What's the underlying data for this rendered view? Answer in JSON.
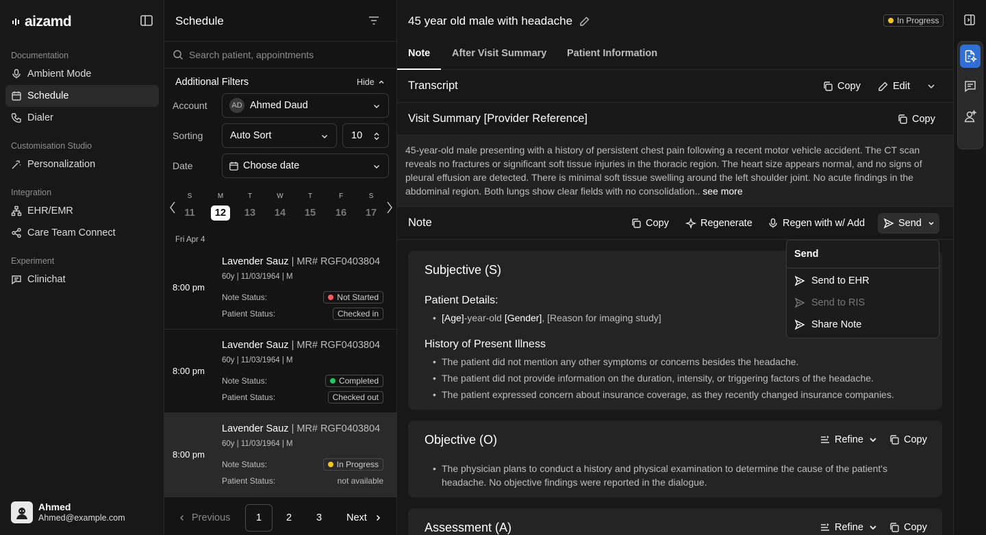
{
  "brand": {
    "logo": "aizamd"
  },
  "sidebar": {
    "sections": [
      {
        "label": "Documentation",
        "items": [
          {
            "label": "Ambient Mode",
            "icon": "mic-icon"
          },
          {
            "label": "Schedule",
            "icon": "calendar-icon",
            "active": true
          },
          {
            "label": "Dialer",
            "icon": "phone-icon"
          }
        ]
      },
      {
        "label": "Customisation Studio",
        "items": [
          {
            "label": "Personalization",
            "icon": "wand-icon"
          }
        ]
      },
      {
        "label": "Integration",
        "items": [
          {
            "label": "EHR/EMR",
            "icon": "network-icon"
          },
          {
            "label": "Care Team Connect",
            "icon": "share-icon"
          }
        ]
      },
      {
        "label": "Experiment",
        "items": [
          {
            "label": "Clinichat",
            "icon": "chat-icon"
          }
        ]
      }
    ],
    "user": {
      "name": "Ahmed",
      "email": "Ahmed@example.com"
    }
  },
  "schedule": {
    "title": "Schedule",
    "search_placeholder": "Search patient, appointments",
    "filters": {
      "title": "Additional Filters",
      "hide_label": "Hide",
      "account_label": "Account",
      "account_initials": "AD",
      "account_value": "Ahmed Daud",
      "sorting_label": "Sorting",
      "sorting_value": "Auto Sort",
      "count_value": "10",
      "date_label": "Date",
      "date_placeholder": "Choose date"
    },
    "calendar": {
      "days": [
        "S",
        "M",
        "T",
        "W",
        "T",
        "F",
        "S"
      ],
      "dates": [
        "11",
        "12",
        "13",
        "14",
        "15",
        "16",
        "17"
      ],
      "selected_index": 1
    },
    "date_group": "Fri Apr 4",
    "appointments": [
      {
        "time": "8:00 pm",
        "name": "Lavender Sauz",
        "mr": "| MR# RGF0403804",
        "meta": "60y | 11/03/1964 | M",
        "note_label": "Note Status:",
        "note_status": "Not Started",
        "patient_label": "Patient Status:",
        "patient_status": "Checked in"
      },
      {
        "time": "8:00 pm",
        "name": "Lavender Sauz",
        "mr": "| MR# RGF0403804",
        "meta": "60y | 11/03/1964 | M",
        "note_label": "Note Status:",
        "note_status": "Completed",
        "patient_label": "Patient Status:",
        "patient_status": "Checked out"
      },
      {
        "time": "8:00 pm",
        "name": "Lavender Sauz",
        "mr": "| MR# RGF0403804",
        "meta": "60y | 11/03/1964 | M",
        "note_label": "Note Status:",
        "note_status": "In Progress",
        "patient_label": "Patient Status:",
        "patient_status": "not available"
      }
    ],
    "pager": {
      "previous": "Previous",
      "pages": [
        "1",
        "2",
        "3"
      ],
      "next": "Next",
      "current": "1"
    }
  },
  "main": {
    "title": "45 year old male with headache",
    "status": "In Progress",
    "tabs": [
      "Note",
      "After Visit Summary",
      "Patient Information"
    ],
    "transcript": {
      "title": "Transcript",
      "copy": "Copy",
      "edit": "Edit"
    },
    "visit_summary": {
      "title": "Visit Summary [Provider Reference]",
      "copy": "Copy",
      "text": "45-year-old male presenting with a history of persistent chest pain following a recent motor vehicle accident. The CT scan reveals no fractures or significant soft tissue injuries in the thoracic region. The heart size appears normal, and no signs of pleural effusion are detected. There is minimal soft tissue swelling around the left shoulder joint. No acute findings in the abdominal region. Both lungs show clear fields with no consolidation..",
      "see_more": "see more"
    },
    "note_bar": {
      "title": "Note",
      "copy": "Copy",
      "regenerate": "Regenerate",
      "regen_add": "Regen with w/ Add",
      "send": "Send"
    },
    "subjective": {
      "title": "Subjective (S)",
      "patient_details_heading": "Patient Details:",
      "age": "[Age]",
      "age_suffix": "-year-old ",
      "gender": "[Gender]",
      "reason": ", [Reason for imaging study]",
      "hpi_heading": "History of Present Illness",
      "hpi": [
        "The patient did not mention any other symptoms or concerns besides the headache.",
        "The patient did not provide information on the duration, intensity, or triggering factors of the headache.",
        "The patient expressed concern about insurance coverage, as they recently changed insurance companies."
      ]
    },
    "objective": {
      "title": "Objective (O)",
      "refine": "Refine",
      "copy": "Copy",
      "text": "The physician plans to conduct a history and physical examination to determine the cause of the patient's headache. No objective findings were reported in the dialogue."
    },
    "assessment": {
      "title": "Assessment (A)",
      "refine": "Refine",
      "copy": "Copy"
    }
  },
  "send_menu": {
    "title": "Send",
    "items": [
      {
        "label": "Send to EHR",
        "disabled": false
      },
      {
        "label": "Send to RIS",
        "disabled": true
      },
      {
        "label": "Share Note",
        "disabled": false
      }
    ]
  },
  "colors": {
    "accent": "#2f6fd6",
    "not_started": "#ff5a5a",
    "completed": "#22c55e",
    "in_progress": "#f5c518"
  }
}
